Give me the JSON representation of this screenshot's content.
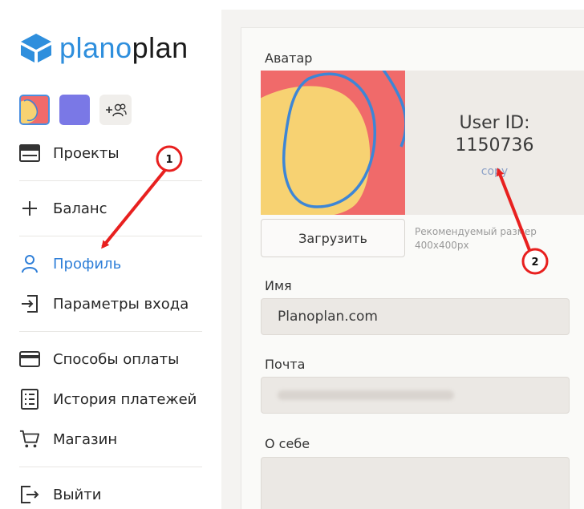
{
  "logo": {
    "prefix": "plano",
    "suffix": "plan",
    "accent_color": "#2f8fdd"
  },
  "sidebar": {
    "items": [
      {
        "label": "Проекты",
        "icon": "projects-icon"
      },
      {
        "label": "Баланс",
        "icon": "plus-icon"
      },
      {
        "label": "Профиль",
        "icon": "user-icon",
        "active": true
      },
      {
        "label": "Параметры входа",
        "icon": "login-icon"
      },
      {
        "label": "Способы оплаты",
        "icon": "credit-card-icon"
      },
      {
        "label": "История платежей",
        "icon": "receipt-icon"
      },
      {
        "label": "Магазин",
        "icon": "cart-icon"
      },
      {
        "label": "Выйти",
        "icon": "logout-icon"
      }
    ],
    "add_workspace_icon": "add-user-icon",
    "active_color": "#2f7fd8"
  },
  "profile": {
    "avatar_label": "Аватар",
    "user_id_title": "User ID:",
    "user_id": "1150736",
    "copy_link": "copy",
    "upload_button": "Загрузить",
    "hint_line1": "Рекомендуемый размер",
    "hint_line2": "400x400px",
    "name_label": "Имя",
    "name_value": "Planoplan.com",
    "email_label": "Почта",
    "about_label": "О себе"
  },
  "annotations": {
    "marker_1": "1",
    "marker_2": "2",
    "color": "#e8201f"
  }
}
